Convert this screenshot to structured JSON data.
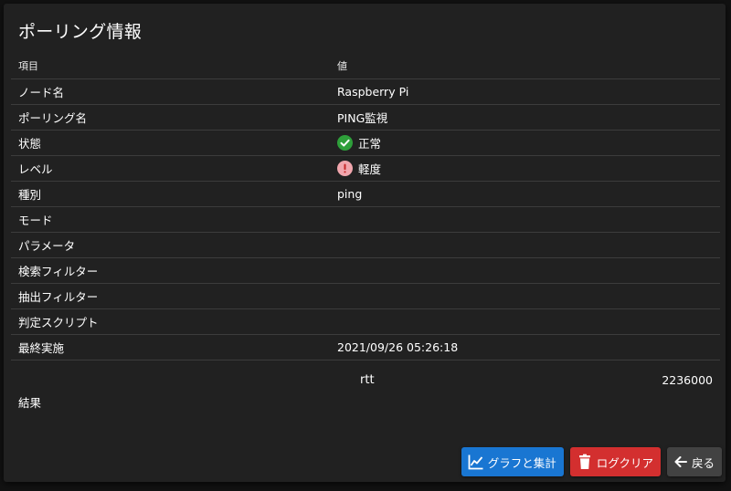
{
  "dialog": {
    "title": "ポーリング情報"
  },
  "table": {
    "header": {
      "item": "項目",
      "value": "値"
    },
    "rows": [
      {
        "label": "ノード名",
        "value": "Raspberry Pi"
      },
      {
        "label": "ポーリング名",
        "value": "PING監視"
      },
      {
        "label": "状態",
        "value": "正常",
        "icon": "check-circle-icon",
        "icon_color": "#2e9f3a"
      },
      {
        "label": "レベル",
        "value": "軽度",
        "icon": "exclamation-circle-icon",
        "icon_color": "#f1a6ad"
      },
      {
        "label": "種別",
        "value": "ping"
      },
      {
        "label": "モード",
        "value": ""
      },
      {
        "label": "パラメータ",
        "value": ""
      },
      {
        "label": "検索フィルター",
        "value": ""
      },
      {
        "label": "抽出フィルター",
        "value": ""
      },
      {
        "label": "判定スクリプト",
        "value": ""
      },
      {
        "label": "最終実施",
        "value": "2021/09/26 05:26:18"
      }
    ],
    "result": {
      "label": "結果",
      "key": "rtt",
      "value": "2236000"
    }
  },
  "actions": {
    "graph_label": "グラフと集計",
    "clear_label": "ログクリア",
    "back_label": "戻る"
  },
  "colors": {
    "graph_button": "#1976d2",
    "clear_button": "#d32f2f",
    "back_button": "#424242",
    "dialog_bg": "#212121"
  }
}
